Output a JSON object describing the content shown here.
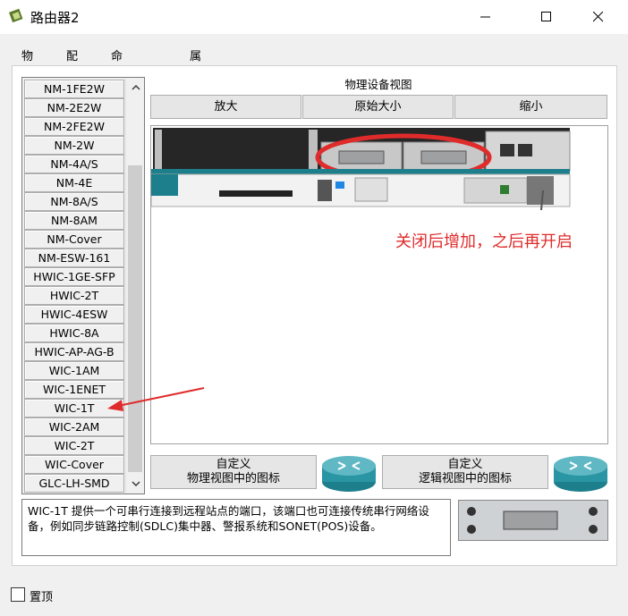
{
  "window": {
    "title": "路由器2",
    "minimize": "—",
    "maximize": "☐",
    "close": "✕"
  },
  "tabs": [
    {
      "label": "物理",
      "active": true
    },
    {
      "label": "配置",
      "active": false
    },
    {
      "label": "命令行界面",
      "active": false
    },
    {
      "label": "属性",
      "active": false
    }
  ],
  "modules": [
    "NM-1FE2W",
    "NM-2E2W",
    "NM-2FE2W",
    "NM-2W",
    "NM-4A/S",
    "NM-4E",
    "NM-8A/S",
    "NM-8AM",
    "NM-Cover",
    "NM-ESW-161",
    "HWIC-1GE-SFP",
    "HWIC-2T",
    "HWIC-4ESW",
    "HWIC-8A",
    "HWIC-AP-AG-B",
    "WIC-1AM",
    "WIC-1ENET",
    "WIC-1T",
    "WIC-2AM",
    "WIC-2T",
    "WIC-Cover",
    "GLC-LH-SMD"
  ],
  "selected_module": "WIC-1T",
  "physical_view": {
    "title": "物理设备视图",
    "zoom_in": "放大",
    "original_size": "原始大小",
    "zoom_out": "缩小"
  },
  "annotation": "关闭后增加，之后再开启",
  "custom_phys": {
    "line1": "自定义",
    "line2": "物理视图中的图标"
  },
  "custom_logic": {
    "line1": "自定义",
    "line2": "逻辑视图中的图标"
  },
  "description": "WIC-1T 提供一个可串行连接到远程站点的端口，该端口也可连接传统串行网络设备，例如同步链路控制(SDLC)集中器、警报系统和SONET(POS)设备。",
  "always_on_top": "置顶",
  "colors": {
    "accent": "#1a5fb4",
    "annotation": "#e02b2b",
    "router_teal": "#1d7f8c"
  }
}
